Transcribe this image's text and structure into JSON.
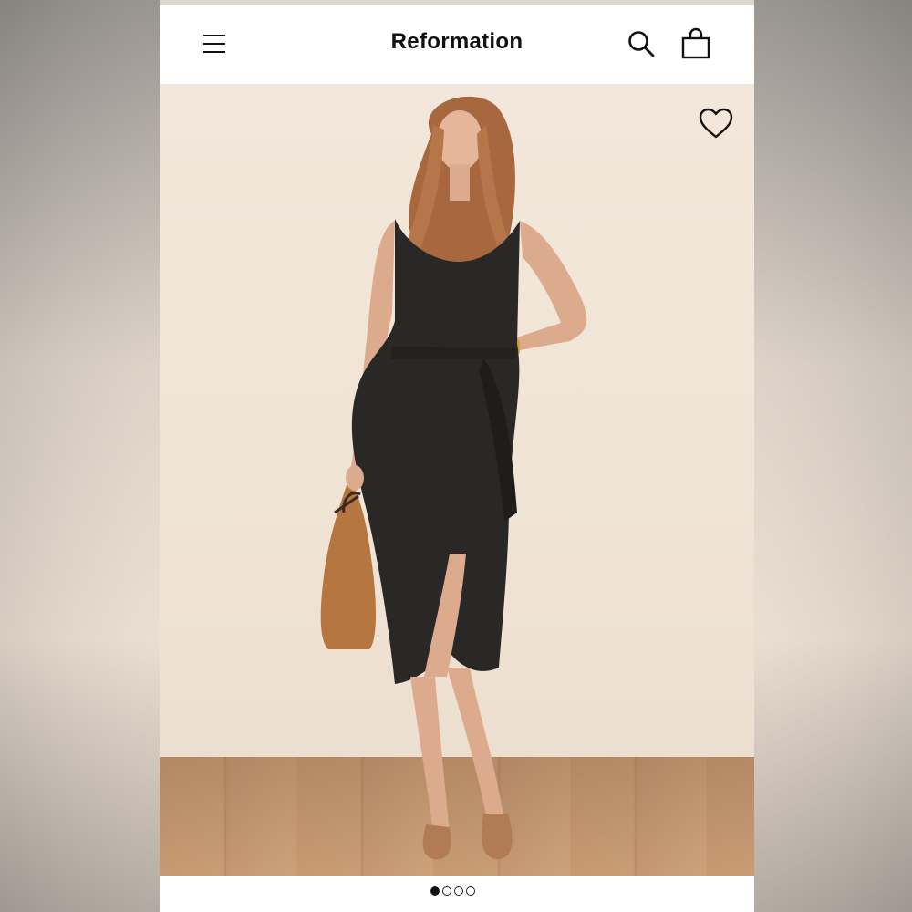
{
  "header": {
    "brand": "Reformation",
    "menu_icon": "menu-icon",
    "search_icon": "search-icon",
    "bag_icon": "shopping-bag-icon"
  },
  "product_gallery": {
    "wishlist_icon": "heart-icon",
    "image_description_hidden": true,
    "carousel": {
      "total_slides": 4,
      "active_slide": 1
    }
  },
  "colors": {
    "accent": "#111111",
    "background": "#ffffff",
    "backdrop": "#f0e4d6"
  }
}
